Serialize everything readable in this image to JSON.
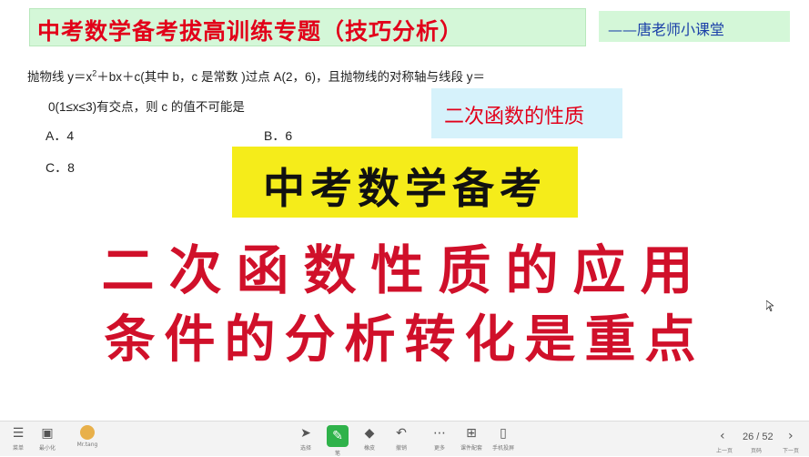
{
  "header": {
    "title": "中考数学备考拔高训练专题（技巧分析）",
    "attribution": "——唐老师小课堂"
  },
  "problem": {
    "line1_pre": "抛物线  y＝x",
    "line1_sup": "2",
    "line1_post": "＋bx＋c(其中  b，c 是常数 )过点  A(2，6)，且抛物线的对称轴与线段   y＝",
    "line2": "0(1≤x≤3)有交点，则  c 的值不可能是",
    "options": {
      "a": "A．4",
      "b": "B．6",
      "c": "C．8"
    }
  },
  "topic_label": "二次函数的性质",
  "yellow_banner": "中考数学备考",
  "big_text": {
    "line1": "二次函数性质的应用",
    "line2": "条件的分析转化是重点"
  },
  "toolbar": {
    "menu_label": "菜单",
    "minimize_label": "最小化",
    "user_label": "Mr.tang",
    "select_label": "选择",
    "pen_label": "笔",
    "eraser_label": "橡皮",
    "undo_label": "撤销",
    "more_label": "更多",
    "extra1_label": "课件配套",
    "extra2_label": "手机投屏",
    "page_indicator": "26 / 52",
    "prev_label": "上一页",
    "pages_label": "页码",
    "next_label": "下一页"
  },
  "colors": {
    "title_red": "#e2001a",
    "banner_green": "#d4f7d8",
    "attrib_blue": "#1a3fa8",
    "topic_bg": "#d6f2fb",
    "yellow": "#f5ec1a",
    "big_red": "#d0102a",
    "pen_green": "#2fb24a"
  }
}
